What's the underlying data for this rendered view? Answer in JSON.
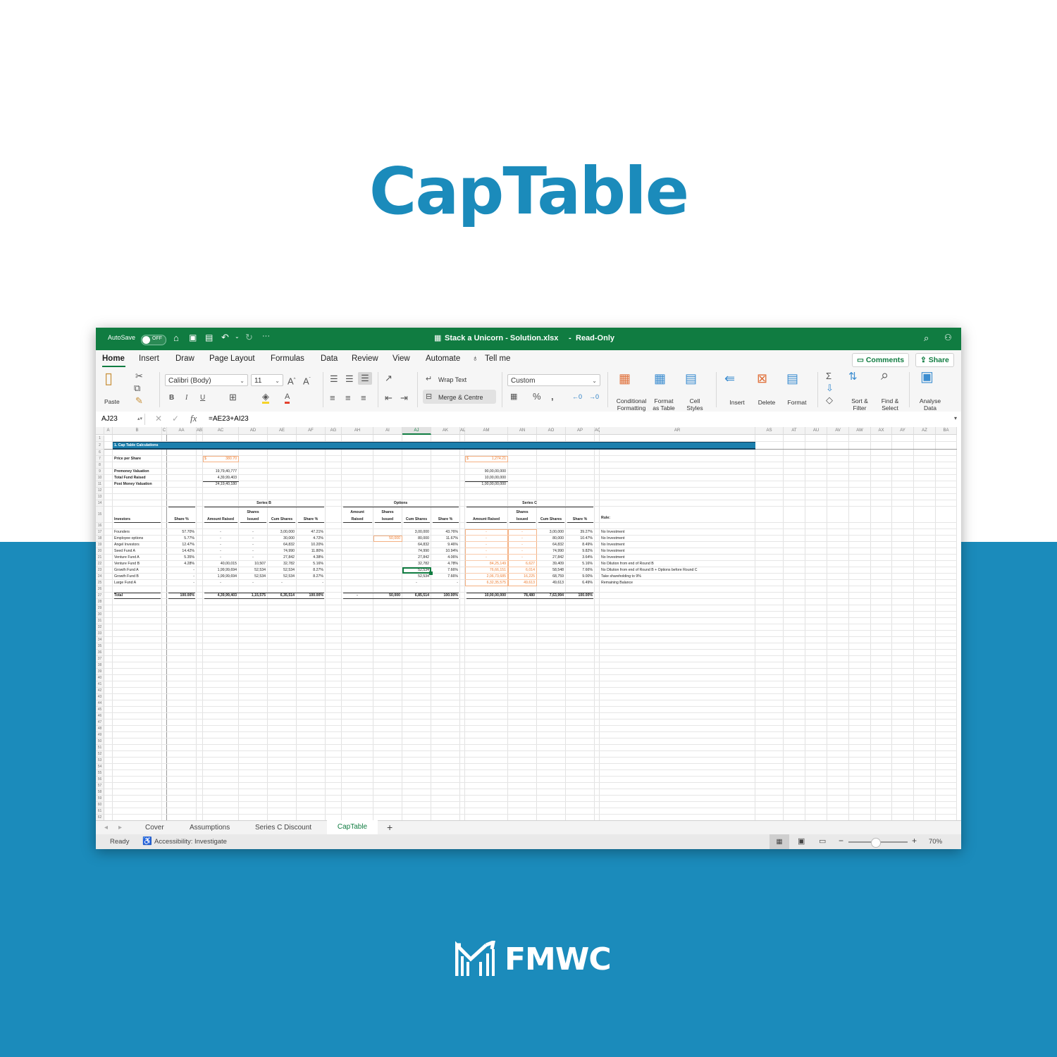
{
  "page": {
    "title": "CapTable",
    "brand": "FMWC",
    "colors": {
      "accent": "#1b8bbb",
      "excel_green": "#107c41",
      "input_orange": "#ed7d31"
    }
  },
  "window": {
    "autosave_label": "AutoSave",
    "autosave_state": "OFF",
    "file_title": "Stack a Unicorn - Solution.xlsx",
    "mode": "Read-Only",
    "tabs": [
      "Home",
      "Insert",
      "Draw",
      "Page Layout",
      "Formulas",
      "Data",
      "Review",
      "View",
      "Automate"
    ],
    "tell_me": "Tell me",
    "comments_label": "Comments",
    "share_label": "Share"
  },
  "ribbon": {
    "paste": "Paste",
    "font_name": "Calibri (Body)",
    "font_size": "11",
    "bold": "B",
    "italic": "I",
    "underline": "U",
    "wrap_text": "Wrap Text",
    "merge_centre": "Merge & Centre",
    "number_format": "Custom",
    "conditional_formatting": [
      "Conditional",
      "Formatting"
    ],
    "format_as_table": [
      "Format",
      "as Table"
    ],
    "cell_styles": [
      "Cell",
      "Styles"
    ],
    "insert": "Insert",
    "delete": "Delete",
    "format": "Format",
    "sort_filter": [
      "Sort &",
      "Filter"
    ],
    "find_select": [
      "Find &",
      "Select"
    ],
    "analyse_data": [
      "Analyse",
      "Data"
    ]
  },
  "formula_bar": {
    "name_box": "AJ23",
    "formula": "=AE23+AI23"
  },
  "columns": [
    "A",
    "B",
    "C",
    "AA",
    "AB",
    "AC",
    "AD",
    "AE",
    "AF",
    "AG",
    "AH",
    "AI",
    "AJ",
    "AK",
    "AL",
    "AM",
    "AN",
    "AO",
    "AP",
    "AQ",
    "AR",
    "AS",
    "AT",
    "AU",
    "AV",
    "AW",
    "AX",
    "AY",
    "AZ",
    "BA"
  ],
  "selected_column": "AJ",
  "rows": [
    "1",
    "2",
    "6",
    "7",
    "8",
    "9",
    "10",
    "11",
    "12",
    "13",
    "14",
    "15",
    "16",
    "17",
    "18",
    "19",
    "20",
    "21",
    "22",
    "23",
    "24",
    "25",
    "26",
    "27",
    "28",
    "29",
    "30",
    "31",
    "32",
    "33",
    "34",
    "35",
    "36",
    "37",
    "38",
    "39",
    "40",
    "41",
    "42",
    "43",
    "44",
    "45",
    "46",
    "47",
    "48",
    "49",
    "50",
    "51",
    "52",
    "53",
    "54",
    "55",
    "56",
    "57",
    "58",
    "59",
    "60",
    "61",
    "62"
  ],
  "sheet": {
    "section_title": "1. Cap Table Calculations",
    "summary_labels": [
      "Price per Share",
      "Premoney Valuation",
      "Total Fund Raised",
      "Post Money Valuation"
    ],
    "series_b_summary": {
      "currency": "$",
      "price": "380.70",
      "premoney": "19,79,40,777",
      "raised": "4,39,99,403",
      "postmoney": "24,19,40,180"
    },
    "series_c_summary": {
      "currency": "$",
      "price": "1,274.21",
      "premoney": "90,00,00,000",
      "raised": "10,00,00,000",
      "postmoney": "1,00,00,00,000"
    },
    "group_headers": {
      "series_b": "Series B",
      "options": "Options",
      "series_c": "Series C"
    },
    "headers": {
      "investors": "Investors",
      "share_pct": "Share %",
      "amount_raised": "Amount Raised",
      "amount": "Amount",
      "raised": "Raised",
      "shares": "Shares",
      "issued": "Issued",
      "cum_shares": "Cum Shares",
      "rule": "Rule:"
    },
    "investors": [
      {
        "name": "Founders",
        "share_pct": "57.70%",
        "b_amount": "-",
        "b_issued": "-",
        "b_cum": "3,00,000",
        "b_pct": "47.21%",
        "o_amount": "",
        "o_issued": "",
        "o_cum": "3,00,000",
        "o_pct": "43.76%",
        "c_amount": "-",
        "c_issued": "-",
        "c_cum": "3,00,000",
        "c_pct": "39.27%",
        "rule": "No Investment"
      },
      {
        "name": "Employee options",
        "share_pct": "5.77%",
        "b_amount": "-",
        "b_issued": "-",
        "b_cum": "30,000",
        "b_pct": "4.72%",
        "o_amount": "",
        "o_issued": "50,000",
        "o_cum": "80,000",
        "o_pct": "11.67%",
        "c_amount": "-",
        "c_issued": "-",
        "c_cum": "80,000",
        "c_pct": "10.47%",
        "rule": "No Investment"
      },
      {
        "name": "Angel Investors",
        "share_pct": "12.47%",
        "b_amount": "-",
        "b_issued": "-",
        "b_cum": "64,832",
        "b_pct": "10.20%",
        "o_amount": "",
        "o_issued": "",
        "o_cum": "64,832",
        "o_pct": "9.46%",
        "c_amount": "-",
        "c_issued": "-",
        "c_cum": "64,832",
        "c_pct": "8.49%",
        "rule": "No Investment"
      },
      {
        "name": "Seed Fund A",
        "share_pct": "14.42%",
        "b_amount": "-",
        "b_issued": "-",
        "b_cum": "74,990",
        "b_pct": "11.80%",
        "o_amount": "",
        "o_issued": "",
        "o_cum": "74,990",
        "o_pct": "10.94%",
        "c_amount": "-",
        "c_issued": "-",
        "c_cum": "74,990",
        "c_pct": "9.82%",
        "rule": "No Investment"
      },
      {
        "name": "Venture Fund A",
        "share_pct": "5.35%",
        "b_amount": "-",
        "b_issued": "-",
        "b_cum": "27,842",
        "b_pct": "4.38%",
        "o_amount": "",
        "o_issued": "",
        "o_cum": "27,842",
        "o_pct": "4.06%",
        "c_amount": "-",
        "c_issued": "-",
        "c_cum": "27,842",
        "c_pct": "3.64%",
        "rule": "No Investment"
      },
      {
        "name": "Venture Fund B",
        "share_pct": "4.28%",
        "b_amount": "40,00,015",
        "b_issued": "10,507",
        "b_cum": "32,782",
        "b_pct": "5.16%",
        "o_amount": "",
        "o_issued": "",
        "o_cum": "32,782",
        "o_pct": "4.78%",
        "c_amount": "84,25,149",
        "c_issued": "6,627",
        "c_cum": "39,409",
        "c_pct": "5.16%",
        "rule": "No Dilution from end of Round B"
      },
      {
        "name": "Growth Fund A",
        "share_pct": "-",
        "b_amount": "1,99,99,694",
        "b_issued": "52,534",
        "b_cum": "52,534",
        "b_pct": "8.27%",
        "o_amount": "",
        "o_issued": "",
        "o_cum": "52,534",
        "o_pct": "7.66%",
        "c_amount": "76,66,151",
        "c_issued": "6,014",
        "c_cum": "58,548",
        "c_pct": "7.66%",
        "rule": "No Dilution from end of Round B + Options before Round C"
      },
      {
        "name": "Growth Fund B",
        "share_pct": "-",
        "b_amount": "1,99,99,694",
        "b_issued": "52,534",
        "b_cum": "52,534",
        "b_pct": "8.27%",
        "o_amount": "",
        "o_issued": "",
        "o_cum": "52,534",
        "o_pct": "7.66%",
        "c_amount": "2,06,73,685",
        "c_issued": "16,225",
        "c_cum": "68,759",
        "c_pct": "9.00%",
        "rule": "Take shareholding to 9%"
      },
      {
        "name": "Large Fund A",
        "share_pct": "-",
        "b_amount": "-",
        "b_issued": "-",
        "b_cum": "-",
        "b_pct": "-",
        "o_amount": "",
        "o_issued": "",
        "o_cum": "-",
        "o_pct": "-",
        "c_amount": "6,32,35,575",
        "c_issued": "49,613",
        "c_cum": "49,613",
        "c_pct": "6.49%",
        "rule": "Remaining Balance"
      }
    ],
    "total": {
      "name": "Total",
      "share_pct": "100.00%",
      "b_amount": "4,39,99,403",
      "b_issued": "1,15,575",
      "b_cum": "6,35,514",
      "b_pct": "100.00%",
      "o_amount": "-",
      "o_issued": "50,000",
      "o_cum": "6,85,514",
      "o_pct": "100.00%",
      "c_amount": "10,00,00,000",
      "c_issued": "78,480",
      "c_cum": "7,63,994",
      "c_pct": "100.00%"
    }
  },
  "sheet_tabs": [
    "Cover",
    "Assumptions",
    "Series C Discount",
    "CapTable"
  ],
  "active_sheet": "CapTable",
  "status": {
    "ready": "Ready",
    "accessibility": "Accessibility: Investigate",
    "zoom": "70%",
    "zoom_fraction": 0.45
  }
}
